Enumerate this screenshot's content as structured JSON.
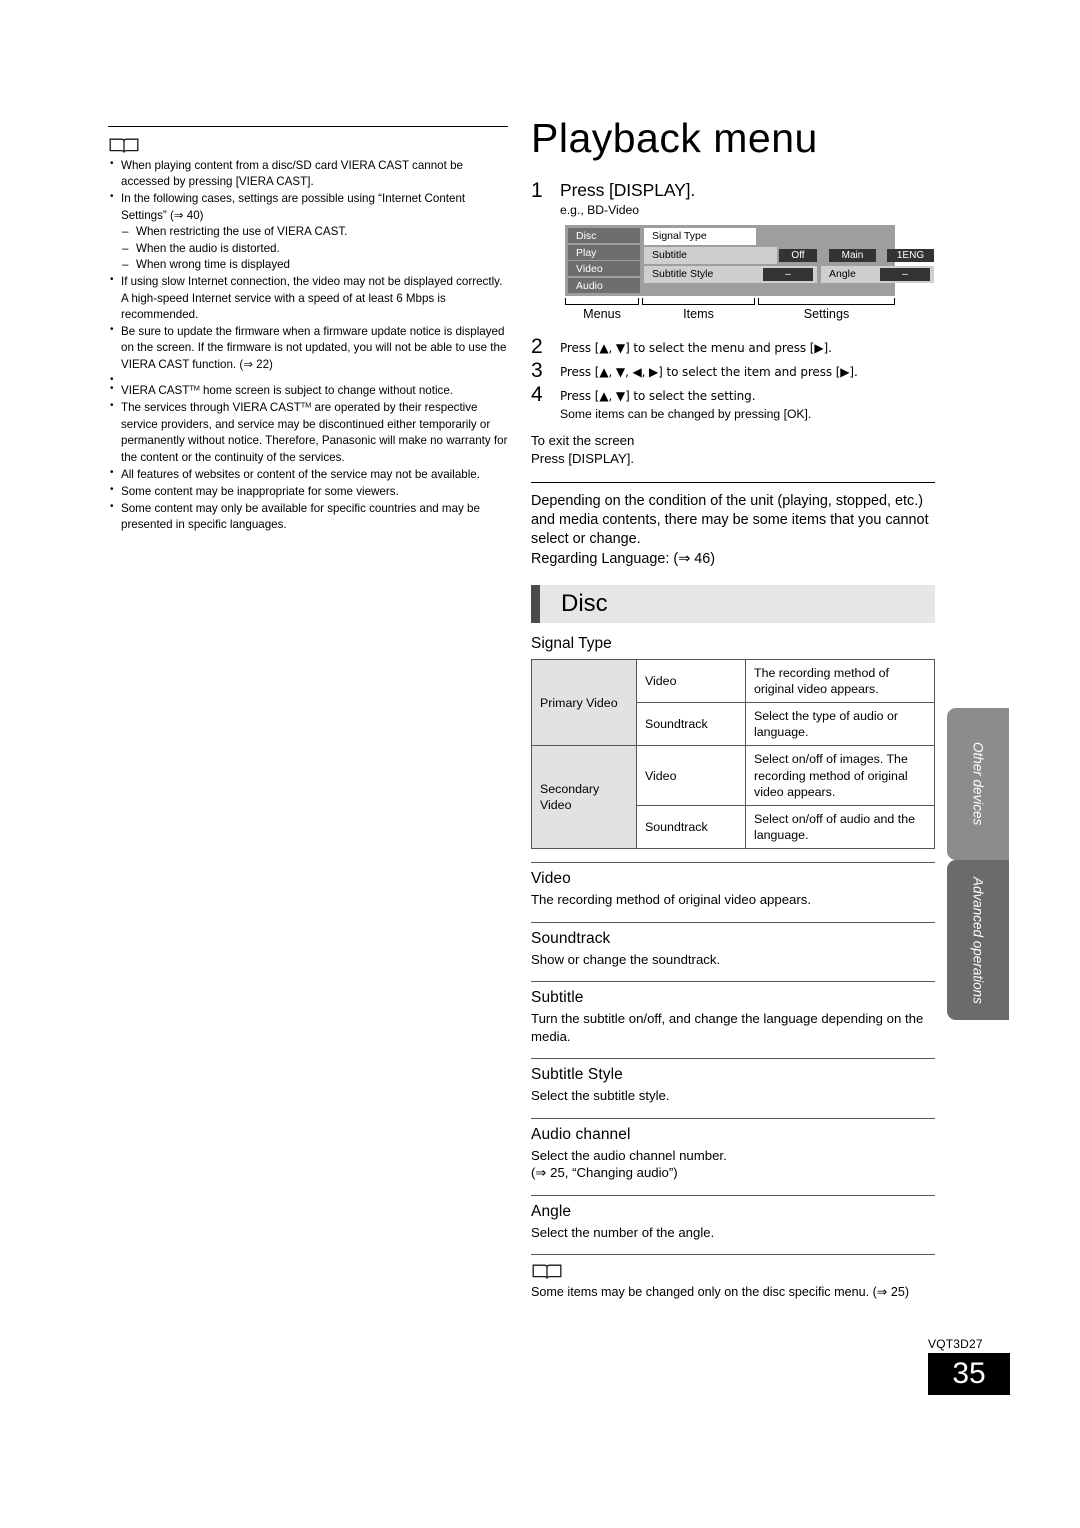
{
  "left_column": {
    "icon": "open-book-icon",
    "notes": [
      {
        "text": "When playing content from a disc/SD card VIERA CAST cannot be accessed by pressing [VIERA CAST]."
      },
      {
        "text": "In the following cases, settings are possible using “Internet Content Settings” (⇒ 40)",
        "sub_items": [
          "When restricting the use of VIERA CAST.",
          "When the audio is distorted.",
          "When wrong time is displayed"
        ]
      },
      {
        "text": "If using slow Internet connection, the video may not be displayed correctly. A high-speed Internet service with a speed of at least 6 Mbps is recommended."
      },
      {
        "text": "Be sure to update the firmware when a firmware update notice is displayed on the screen. If the firmware is not updated, you will not be able to use the VIERA CAST function. (⇒ 22)"
      },
      {
        "text": "VIERA CAST™ home screen is subject to change without notice.",
        "spaced": true
      },
      {
        "text": "The services through VIERA CAST™ are operated by their respective service providers, and service may be discontinued either temporarily or permanently without notice. Therefore, Panasonic will make no warranty for the content or the continuity of the services."
      },
      {
        "text": "All features of websites or content of the service may not be available."
      },
      {
        "text": "Some content may be inappropriate for some viewers."
      },
      {
        "text": "Some content may only be available for specific countries and may be presented in specific languages."
      }
    ]
  },
  "right_column": {
    "title": "Playback menu",
    "steps": [
      {
        "num": "1",
        "text": "Press [DISPLAY].",
        "sub": "e.g., BD-Video"
      },
      {
        "num": "2",
        "text": "Press [▲, ▼] to select the menu and press [▶]."
      },
      {
        "num": "3",
        "text": "Press [▲, ▼, ◀, ▶] to select the item and press [▶]."
      },
      {
        "num": "4",
        "text": "Press [▲, ▼] to select the setting.",
        "sub": "Some items can be changed by pressing [OK]."
      }
    ],
    "exit": {
      "heading": "To exit the screen",
      "body": "Press [DISPLAY]."
    },
    "menu_mock": {
      "menus": [
        "Disc",
        "Play",
        "Video",
        "Audio"
      ],
      "rows": [
        {
          "item": "Signal Type",
          "style": "white"
        },
        {
          "item": "Subtitle",
          "settings": [
            "Off",
            "Main",
            "1ENG"
          ]
        },
        {
          "item": "Subtitle Style",
          "setting": "–",
          "item2": "Angle",
          "setting2": "–"
        }
      ],
      "brackets": [
        "Menus",
        "Items",
        "Settings"
      ]
    },
    "paragraph": "Depending on the condition of the unit (playing, stopped, etc.) and media contents, there may be some items that you cannot select or change.",
    "paragraph_ref": "Regarding Language: (⇒ 46)",
    "section_title": "Disc",
    "signal_type": {
      "heading": "Signal Type",
      "rows": [
        {
          "category": "Primary Video",
          "type": "Video",
          "desc": "The recording method of original video appears."
        },
        {
          "category": "Primary Video",
          "type": "Soundtrack",
          "desc": "Select the type of audio or language."
        },
        {
          "category": "Secondary Video",
          "type": "Video",
          "desc": "Select on/off of images. The recording method of original video appears."
        },
        {
          "category": "Secondary Video",
          "type": "Soundtrack",
          "desc": "Select on/off of audio and the language."
        }
      ]
    },
    "entries": [
      {
        "term": "Video",
        "def": "The recording method of original video appears."
      },
      {
        "term": "Soundtrack",
        "def": "Show or change the soundtrack."
      },
      {
        "term": "Subtitle",
        "def": "Turn the subtitle on/off, and change the language depending on the media."
      },
      {
        "term": "Subtitle Style",
        "def": "Select the subtitle style."
      },
      {
        "term": "Audio channel",
        "def": "Select the audio channel number.\n(⇒ 25, “Changing audio”)"
      },
      {
        "term": "Angle",
        "def": "Select the number of the angle."
      }
    ],
    "footer_note": {
      "icon": "open-book-icon",
      "text": "Some items may be changed only on the disc specific menu. (⇒ 25)"
    }
  },
  "side_tabs": [
    {
      "label": "Other devices",
      "color": "#8c8c8c"
    },
    {
      "label": "Advanced operations",
      "color": "#6b6b6b"
    }
  ],
  "page_footer": {
    "doc_code": "VQT3D27",
    "page_number": "35"
  }
}
